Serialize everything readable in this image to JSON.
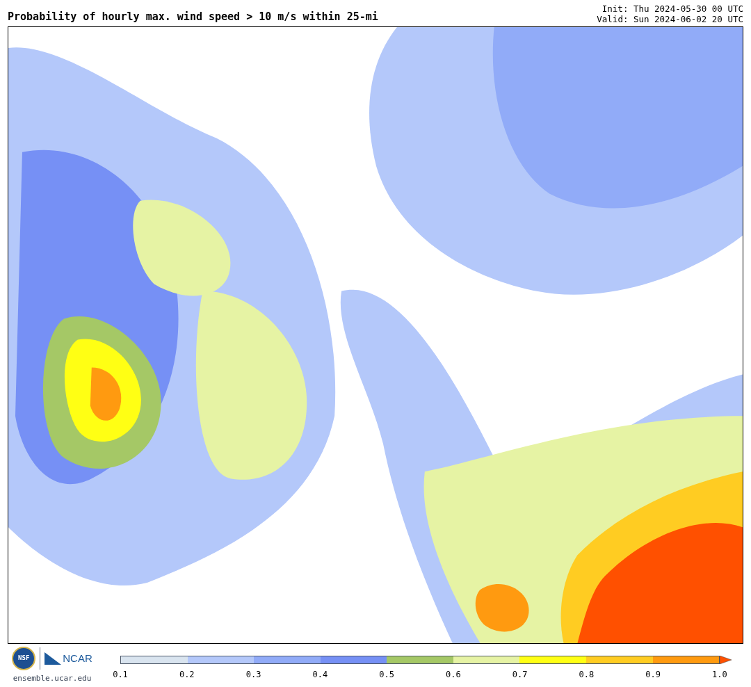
{
  "title": "Probability of hourly max. wind speed > 10 m/s within 25-mi",
  "init": "Init: Thu 2024-05-30 00 UTC",
  "valid": "Valid: Sun 2024-06-02 20 UTC",
  "logos": {
    "nsf": "NSF",
    "ncar": "NCAR"
  },
  "url": "ensemble.ucar.edu",
  "colorbar": {
    "segments": [
      {
        "color": "#d9e4ef"
      },
      {
        "color": "#b4c8fa"
      },
      {
        "color": "#91abf8"
      },
      {
        "color": "#7690f5"
      },
      {
        "color": "#a5c866"
      },
      {
        "color": "#e6f3a4"
      },
      {
        "color": "#ffff14"
      },
      {
        "color": "#ffcc22"
      },
      {
        "color": "#ff9a10"
      }
    ],
    "over_arrow": {
      "color": "#ff5000"
    },
    "ticks": [
      "0.1",
      "0.2",
      "0.3",
      "0.4",
      "0.5",
      "0.6",
      "0.7",
      "0.8",
      "0.9",
      "1.0"
    ]
  }
}
